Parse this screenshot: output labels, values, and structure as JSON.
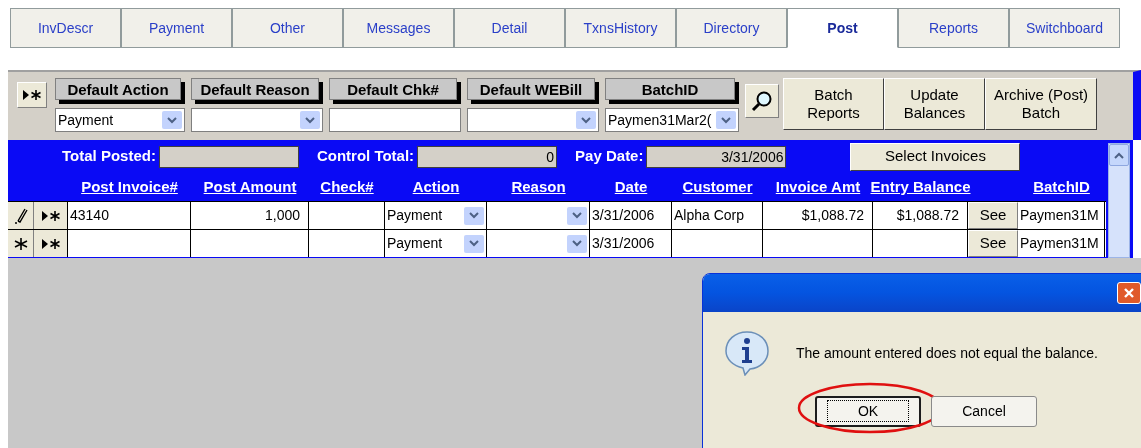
{
  "tabs": [
    {
      "label": "InvDescr",
      "selected": false
    },
    {
      "label": "Payment",
      "selected": false
    },
    {
      "label": "Other",
      "selected": false
    },
    {
      "label": "Messages",
      "selected": false
    },
    {
      "label": "Detail",
      "selected": false
    },
    {
      "label": "TxnsHistory",
      "selected": false
    },
    {
      "label": "Directory",
      "selected": false
    },
    {
      "label": "Post",
      "selected": true
    },
    {
      "label": "Reports",
      "selected": false
    },
    {
      "label": "Switchboard",
      "selected": false
    }
  ],
  "defaults": [
    {
      "label": "Default Action",
      "kind": "combo",
      "value": "Payment"
    },
    {
      "label": "Default Reason",
      "kind": "combo"
    },
    {
      "label": "Default Chk#",
      "kind": "text"
    },
    {
      "label": "Default WEBill",
      "kind": "combo"
    },
    {
      "label": "BatchID",
      "kind": "combo",
      "value": "Paymen31Mar2("
    }
  ],
  "action_buttons": [
    {
      "label": "Batch\nReports"
    },
    {
      "label": "Update\nBalances"
    },
    {
      "label": "Archive (Post)\nBatch"
    }
  ],
  "totals": [
    {
      "label": "Total Posted:"
    },
    {
      "label": "Control Total:",
      "value": "0"
    },
    {
      "label": "Pay Date:",
      "value": "3/31/2006"
    }
  ],
  "select_invoices_button": "Select Invoices",
  "columns": [
    {
      "label": "Post Invoice#",
      "kind": "text"
    },
    {
      "label": "Post Amount",
      "kind": "text"
    },
    {
      "label": "Check#",
      "kind": "text"
    },
    {
      "label": "Action",
      "kind": "combo"
    },
    {
      "label": "Reason",
      "kind": "combo"
    },
    {
      "label": "Date",
      "kind": "text"
    },
    {
      "label": "Customer",
      "kind": "text"
    },
    {
      "label": "Invoice Amt",
      "kind": "text"
    },
    {
      "label": "Entry Balance",
      "kind": "text"
    },
    {
      "kind": "button"
    },
    {
      "label": "BatchID",
      "kind": "text"
    }
  ],
  "rows": [
    {
      "kind": "editing",
      "cells": [
        "43140",
        "1,000",
        null,
        "Payment",
        null,
        "3/31/2006",
        "Alpha Corp",
        "$1,088.72",
        "$1,088.72",
        "See",
        "Paymen31M"
      ]
    },
    {
      "kind": "new",
      "cells": [
        null,
        null,
        null,
        "Payment",
        null,
        "3/31/2006",
        null,
        null,
        null,
        "See",
        "Paymen31M"
      ]
    }
  ],
  "dialog": {
    "message": "The amount entered does not equal the balance.",
    "buttons": [
      {
        "label": "OK",
        "focused": true,
        "highlighted": true
      },
      {
        "label": "Cancel",
        "focused": false,
        "highlighted": false
      }
    ]
  }
}
